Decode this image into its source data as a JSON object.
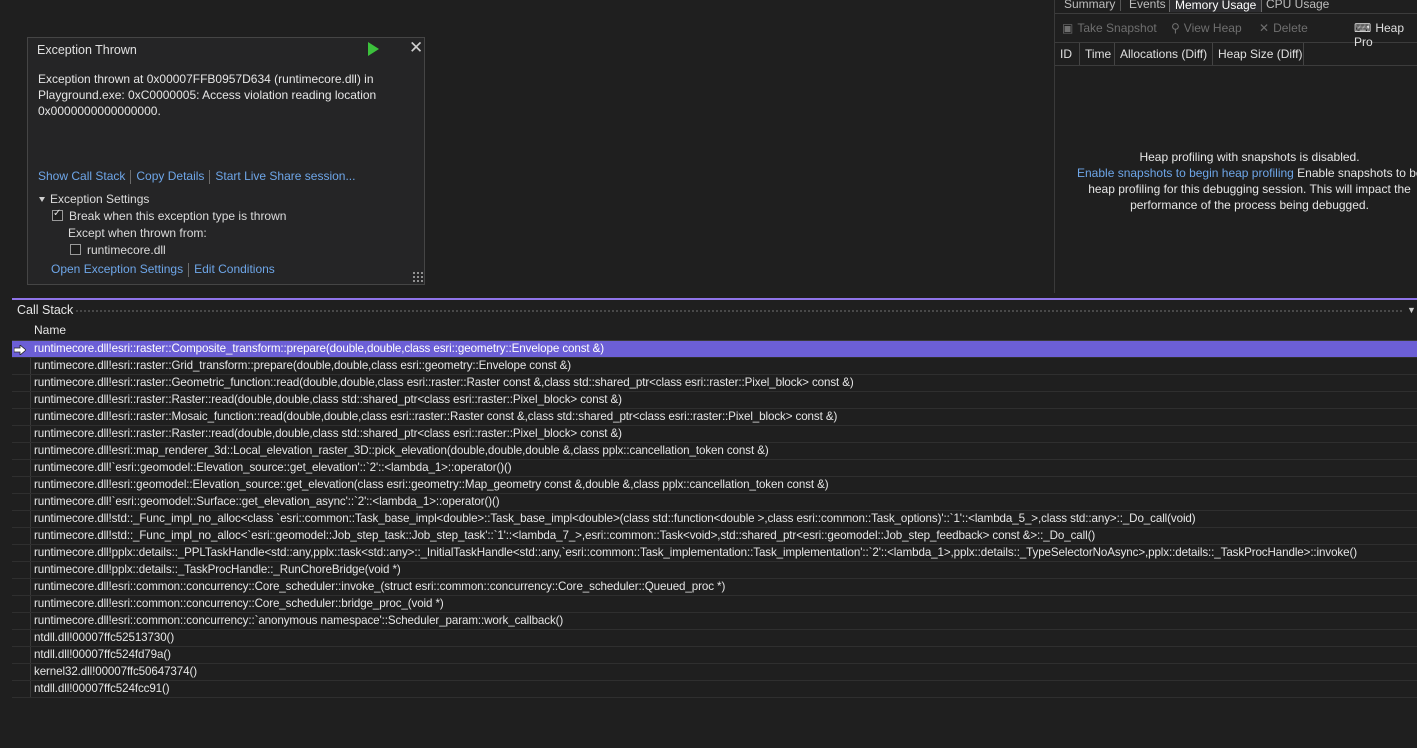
{
  "exception": {
    "title": "Exception Thrown",
    "message": "Exception thrown at 0x00007FFB0957D634 (runtimecore.dll) in Playground.exe: 0xC0000005: Access violation reading location 0x0000000000000000.",
    "links": [
      "Show Call Stack",
      "Copy Details",
      "Start Live Share session..."
    ],
    "settings_label": "Exception Settings",
    "break_label": "Break when this exception type is thrown",
    "except_label": "Except when thrown from:",
    "dll_label": "runtimecore.dll",
    "links2": [
      "Open Exception Settings",
      "Edit Conditions"
    ]
  },
  "diagnostics": {
    "tabs": [
      "Summary",
      "Events",
      "Memory Usage",
      "CPU Usage"
    ],
    "selected_tab": "Memory Usage",
    "toolbar": {
      "take_snapshot": "Take Snapshot",
      "view_heap": "View Heap",
      "delete": "Delete",
      "heap_profile": "Heap Pro"
    },
    "columns": [
      "ID",
      "Time",
      "Allocations (Diff)",
      "Heap Size (Diff)"
    ],
    "heap_message": {
      "line1": "Heap profiling with snapshots is disabled.",
      "link": "Enable snapshots to begin heap profiling",
      "rest_line2": " Enable snapshots to be",
      "line3": "heap profiling  for this debugging session. This will impact the",
      "line4": "performance of the process being debugged."
    }
  },
  "call_stack": {
    "title": "Call Stack",
    "column_name": "Name",
    "frames": [
      "runtimecore.dll!esri::raster::Composite_transform::prepare(double,double,class esri::geometry::Envelope const &)",
      "runtimecore.dll!esri::raster::Grid_transform::prepare(double,double,class esri::geometry::Envelope const &)",
      "runtimecore.dll!esri::raster::Geometric_function::read(double,double,class esri::raster::Raster const &,class std::shared_ptr<class esri::raster::Pixel_block> const &)",
      "runtimecore.dll!esri::raster::Raster::read(double,double,class std::shared_ptr<class esri::raster::Pixel_block> const &)",
      "runtimecore.dll!esri::raster::Mosaic_function::read(double,double,class esri::raster::Raster const &,class std::shared_ptr<class esri::raster::Pixel_block> const &)",
      "runtimecore.dll!esri::raster::Raster::read(double,double,class std::shared_ptr<class esri::raster::Pixel_block> const &)",
      "runtimecore.dll!esri::map_renderer_3d::Local_elevation_raster_3D::pick_elevation(double,double,double &,class pplx::cancellation_token const &)",
      "runtimecore.dll!`esri::geomodel::Elevation_source::get_elevation'::`2'::<lambda_1>::operator()()",
      "runtimecore.dll!esri::geomodel::Elevation_source::get_elevation(class esri::geometry::Map_geometry const &,double &,class pplx::cancellation_token const &)",
      "runtimecore.dll!`esri::geomodel::Surface::get_elevation_async'::`2'::<lambda_1>::operator()()",
      "runtimecore.dll!std::_Func_impl_no_alloc<class `esri::common::Task_base_impl<double>::Task_base_impl<double>(class std::function<double >,class esri::common::Task_options)'::`1'::<lambda_5_>,class std::any>::_Do_call(void)",
      "runtimecore.dll!std::_Func_impl_no_alloc<`esri::geomodel::Job_step_task::Job_step_task'::`1'::<lambda_7_>,esri::common::Task<void>,std::shared_ptr<esri::geomodel::Job_step_feedback> const &>::_Do_call()",
      "runtimecore.dll!pplx::details::_PPLTaskHandle<std::any,pplx::task<std::any>::_InitialTaskHandle<std::any,`esri::common::Task_implementation::Task_implementation'::`2'::<lambda_1>,pplx::details::_TypeSelectorNoAsync>,pplx::details::_TaskProcHandle>::invoke()",
      "runtimecore.dll!pplx::details::_TaskProcHandle::_RunChoreBridge(void *)",
      "runtimecore.dll!esri::common::concurrency::Core_scheduler::invoke_(struct esri::common::concurrency::Core_scheduler::Queued_proc *)",
      "runtimecore.dll!esri::common::concurrency::Core_scheduler::bridge_proc_(void *)",
      "runtimecore.dll!esri::common::concurrency::`anonymous namespace'::Scheduler_param::work_callback()",
      "ntdll.dll!00007ffc52513730()",
      "ntdll.dll!00007ffc524fd79a()",
      "kernel32.dll!00007ffc50647374()",
      "ntdll.dll!00007ffc524fcc91()"
    ]
  }
}
